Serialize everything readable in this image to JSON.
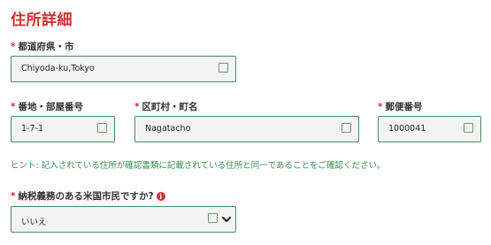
{
  "section": {
    "title": "住所詳細"
  },
  "required_mark": "*",
  "fields": {
    "prefecture_city": {
      "label": "都道府県・市",
      "value": "Chiyoda-ku,Tokyo"
    },
    "block_room": {
      "label": "番地・部屋番号",
      "value": "1-7-1"
    },
    "ward_town": {
      "label": "区町村・町名",
      "value": "Nagatacho"
    },
    "postal_code": {
      "label": "郵便番号",
      "value": "1000041"
    },
    "us_taxpayer": {
      "label": "納税義務のある米国市民ですか?",
      "selected": "いいえ"
    }
  },
  "hint": "ヒント: 記入されている住所が確認書類に記載されている住所と同一であることをご確認ください。",
  "icons": {
    "info": "info-icon",
    "dropdown": "chevron-down-icon",
    "validation": "checkbox-square-icon"
  },
  "colors": {
    "accent": "#d22e35",
    "field_border": "#4b8a5a",
    "hint": "#2f8f4b",
    "field_bg": "#f3f3f3"
  }
}
